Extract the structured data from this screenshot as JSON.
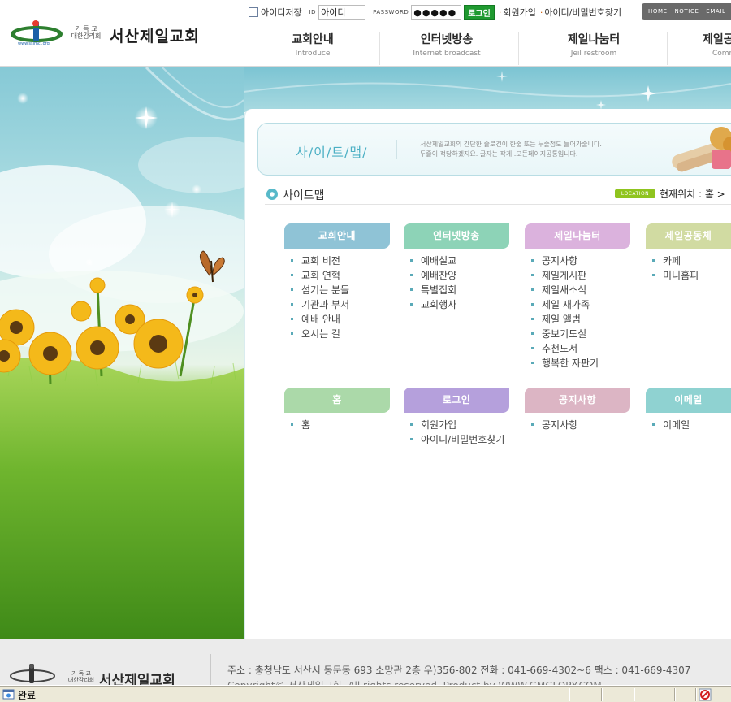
{
  "header": {
    "logo": {
      "sub_top": "기 독 교",
      "sub_bottom": "대한감리회",
      "name": "서산제일교회"
    },
    "login": {
      "remember_label": "아이디저장",
      "id_label": "ID",
      "id_value": "아이디",
      "password_label": "PASSWORD",
      "password_value": "●●●●●",
      "login_button": "로그인",
      "join_link": "회원가입",
      "find_link": "아이디/비밀번호찾기"
    },
    "util_nav": [
      "HOME",
      "NOTICE",
      "EMAIL"
    ],
    "gnb": [
      {
        "ko": "교회안내",
        "en": "Introduce"
      },
      {
        "ko": "인터넷방송",
        "en": "Internet broadcast"
      },
      {
        "ko": "제일나눔터",
        "en": "Jeil restroom"
      },
      {
        "ko": "제일공",
        "en": "Comm"
      }
    ]
  },
  "banner": {
    "title": "사/이/트/맵/",
    "desc_line1": "서산제일교회의 간단한 슬로건이 한줄 또는 두줄정도 들어가줍니다.",
    "desc_line2": "두줄이 적당하겠지요. 글자는 작게..모든페이지공통입니다."
  },
  "section": {
    "title": "사이트맵",
    "location_badge": "LOCATION",
    "location_text": "현재위치 : 홈 >"
  },
  "sitemap": [
    {
      "title": "교회안내",
      "color": "#8fc3d6",
      "items": [
        "교회 비전",
        "교회 연혁",
        "섬기는 분들",
        "기관과 부서",
        "예배 안내",
        "오시는 길"
      ]
    },
    {
      "title": "인터넷방송",
      "color": "#8dd3b7",
      "items": [
        "예배설교",
        "예배찬양",
        "특별집회",
        "교회행사"
      ]
    },
    {
      "title": "제일나눔터",
      "color": "#dbb2dd",
      "items": [
        "공지사항",
        "제일게시판",
        "제일새소식",
        "제일 새가족",
        "제일 앨범",
        "중보기도실",
        "추천도서",
        "행복한 자판기"
      ]
    },
    {
      "title": "제일공동체",
      "color": "#d1dba2",
      "items": [
        "카페",
        "미니홈피"
      ]
    },
    {
      "title": "홈",
      "color": "#abd9a9",
      "items": [
        "홈"
      ]
    },
    {
      "title": "로그인",
      "color": "#b5a0dc",
      "items": [
        "회원가입",
        "아이디/비밀번호찾기"
      ]
    },
    {
      "title": "공지사항",
      "color": "#dcb5c4",
      "items": [
        "공지사항"
      ]
    },
    {
      "title": "이메일",
      "color": "#8fd2d1",
      "items": [
        "이메일"
      ]
    }
  ],
  "footer": {
    "logo_sub_top": "기 독 교",
    "logo_sub_bottom": "대한감리회",
    "logo_name": "서산제일교회",
    "address": "주소 : 충청남도 서산시 동문동 693 소망관 2층 우)356-802    전화 : 041-669-4302~6  팩스 : 041-669-4307",
    "copyright": "Copyright© 서산제일교회. All rights reserved. Product by WWW.GMGLORY.COM"
  },
  "statusbar": {
    "text": "완료"
  }
}
